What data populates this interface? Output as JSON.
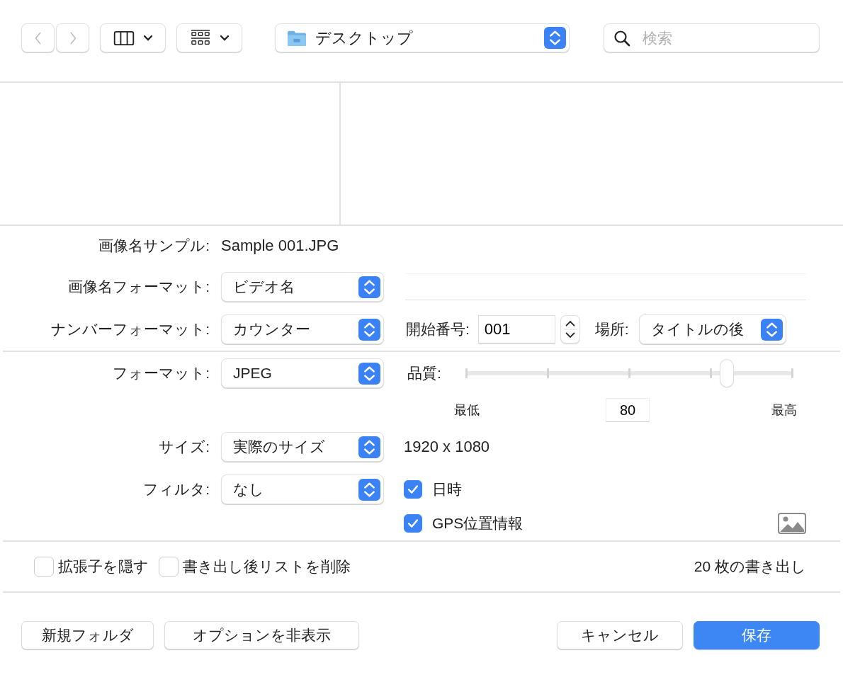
{
  "toolbar": {
    "location": "デスクトップ",
    "search": {
      "placeholder": "検索"
    }
  },
  "options": {
    "image_name_sample": {
      "label": "画像名サンプル:",
      "value": "Sample 001.JPG"
    },
    "image_name_format": {
      "label": "画像名フォーマット:",
      "value": "ビデオ名"
    },
    "number_format": {
      "label": "ナンバーフォーマット:",
      "value": "カウンター"
    },
    "start_number": {
      "label": "開始番号:",
      "value": "001"
    },
    "position": {
      "label": "場所:",
      "value": "タイトルの後"
    },
    "format": {
      "label": "フォーマット:",
      "value": "JPEG"
    },
    "quality": {
      "label": "品質:",
      "level": 0.8,
      "min_label": "最低",
      "max_label": "最高",
      "value": "80"
    },
    "size": {
      "label": "サイズ:",
      "value": "実際のサイズ",
      "dimensions": "1920 x 1080"
    },
    "filter": {
      "label": "フィルタ:",
      "value": "なし"
    },
    "metadata": [
      {
        "label": "日時",
        "checked": true
      },
      {
        "label": "GPS位置情報",
        "checked": true
      }
    ]
  },
  "footer_options": [
    {
      "label": "拡張子を隠す",
      "checked": false
    },
    {
      "label": "書き出し後リストを削除",
      "checked": false
    }
  ],
  "export_count": "20 枚の書き出し",
  "buttons": [
    {
      "label": "新規フォルダ",
      "kind": "normal"
    },
    {
      "label": "オプションを非表示",
      "kind": "normal"
    },
    {
      "label": "キャンセル",
      "kind": "normal"
    },
    {
      "label": "保存",
      "kind": "default"
    }
  ]
}
